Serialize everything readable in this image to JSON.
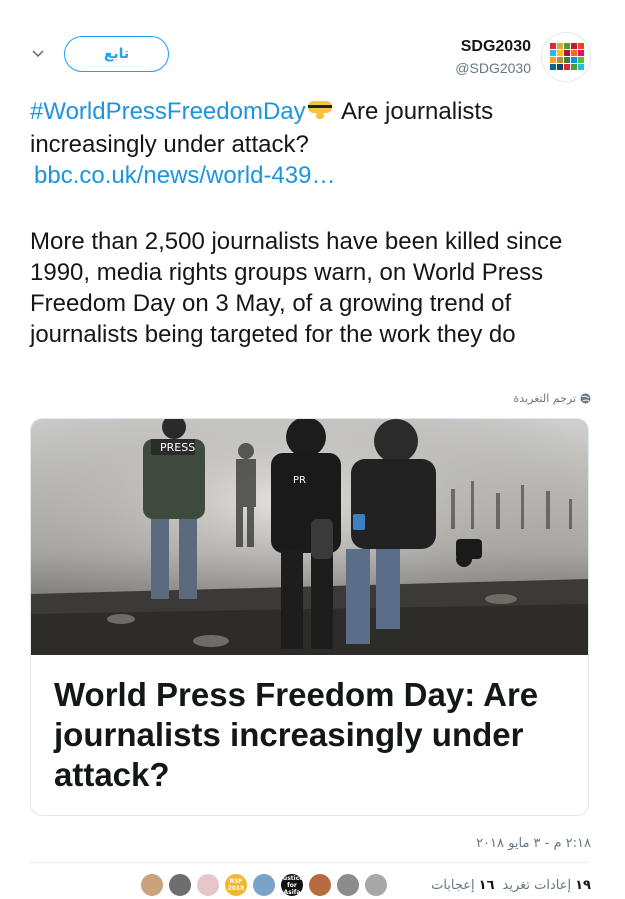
{
  "header": {
    "follow_label": "تابع",
    "display_name": "SDG2030",
    "handle": "@SDG2030",
    "avatar_icon": "sdg-wheel-logo"
  },
  "tweet": {
    "hashtag": "#WorldPressFreedomDay",
    "emoji_icon": "shushing-hand-emoji",
    "text_after_hashtag": " Are journalists increasingly under attack?",
    "link": "bbc.co.uk/news/world-439…",
    "paragraph": "More than 2,500 journalists have been killed since 1990, media rights groups warn, on World Press Freedom Day on 3 May, of a growing trend of journalists being targeted for the work they do",
    "translate_label": "ترجم التغريدة"
  },
  "card": {
    "image_icon": "journalists-in-smoke-photo",
    "image_press_label": "PRESS",
    "image_press_label_2": "PR",
    "title": "World Press Freedom Day: Are journalists increasingly under attack?"
  },
  "meta": {
    "timestamp": "٢:١٨ م - ٣ مايو ٢٠١٨"
  },
  "stats": {
    "retweets_count": "١٩",
    "retweets_label": "إعادات تغريد",
    "likes_count": "١٦",
    "likes_label": "إعجابات"
  },
  "likers": [
    {
      "icon": "avatar-woman",
      "color": "#c9a27e"
    },
    {
      "icon": "avatar-man",
      "color": "#6e6e6e"
    },
    {
      "icon": "avatar-flower",
      "color": "#e7c5c9"
    },
    {
      "icon": "avatar-rsf-2018",
      "color": "#f2b632",
      "label": "RSF 2018"
    },
    {
      "icon": "avatar-building",
      "color": "#7aa3c9"
    },
    {
      "icon": "avatar-justice-for-asifa",
      "color": "#111111",
      "label": "Justice for Asifa"
    },
    {
      "icon": "avatar-woman-2",
      "color": "#b86b3f"
    },
    {
      "icon": "avatar-man-2",
      "color": "#8c8c8c"
    },
    {
      "icon": "avatar-woman-3",
      "color": "#a7a7a7"
    }
  ]
}
